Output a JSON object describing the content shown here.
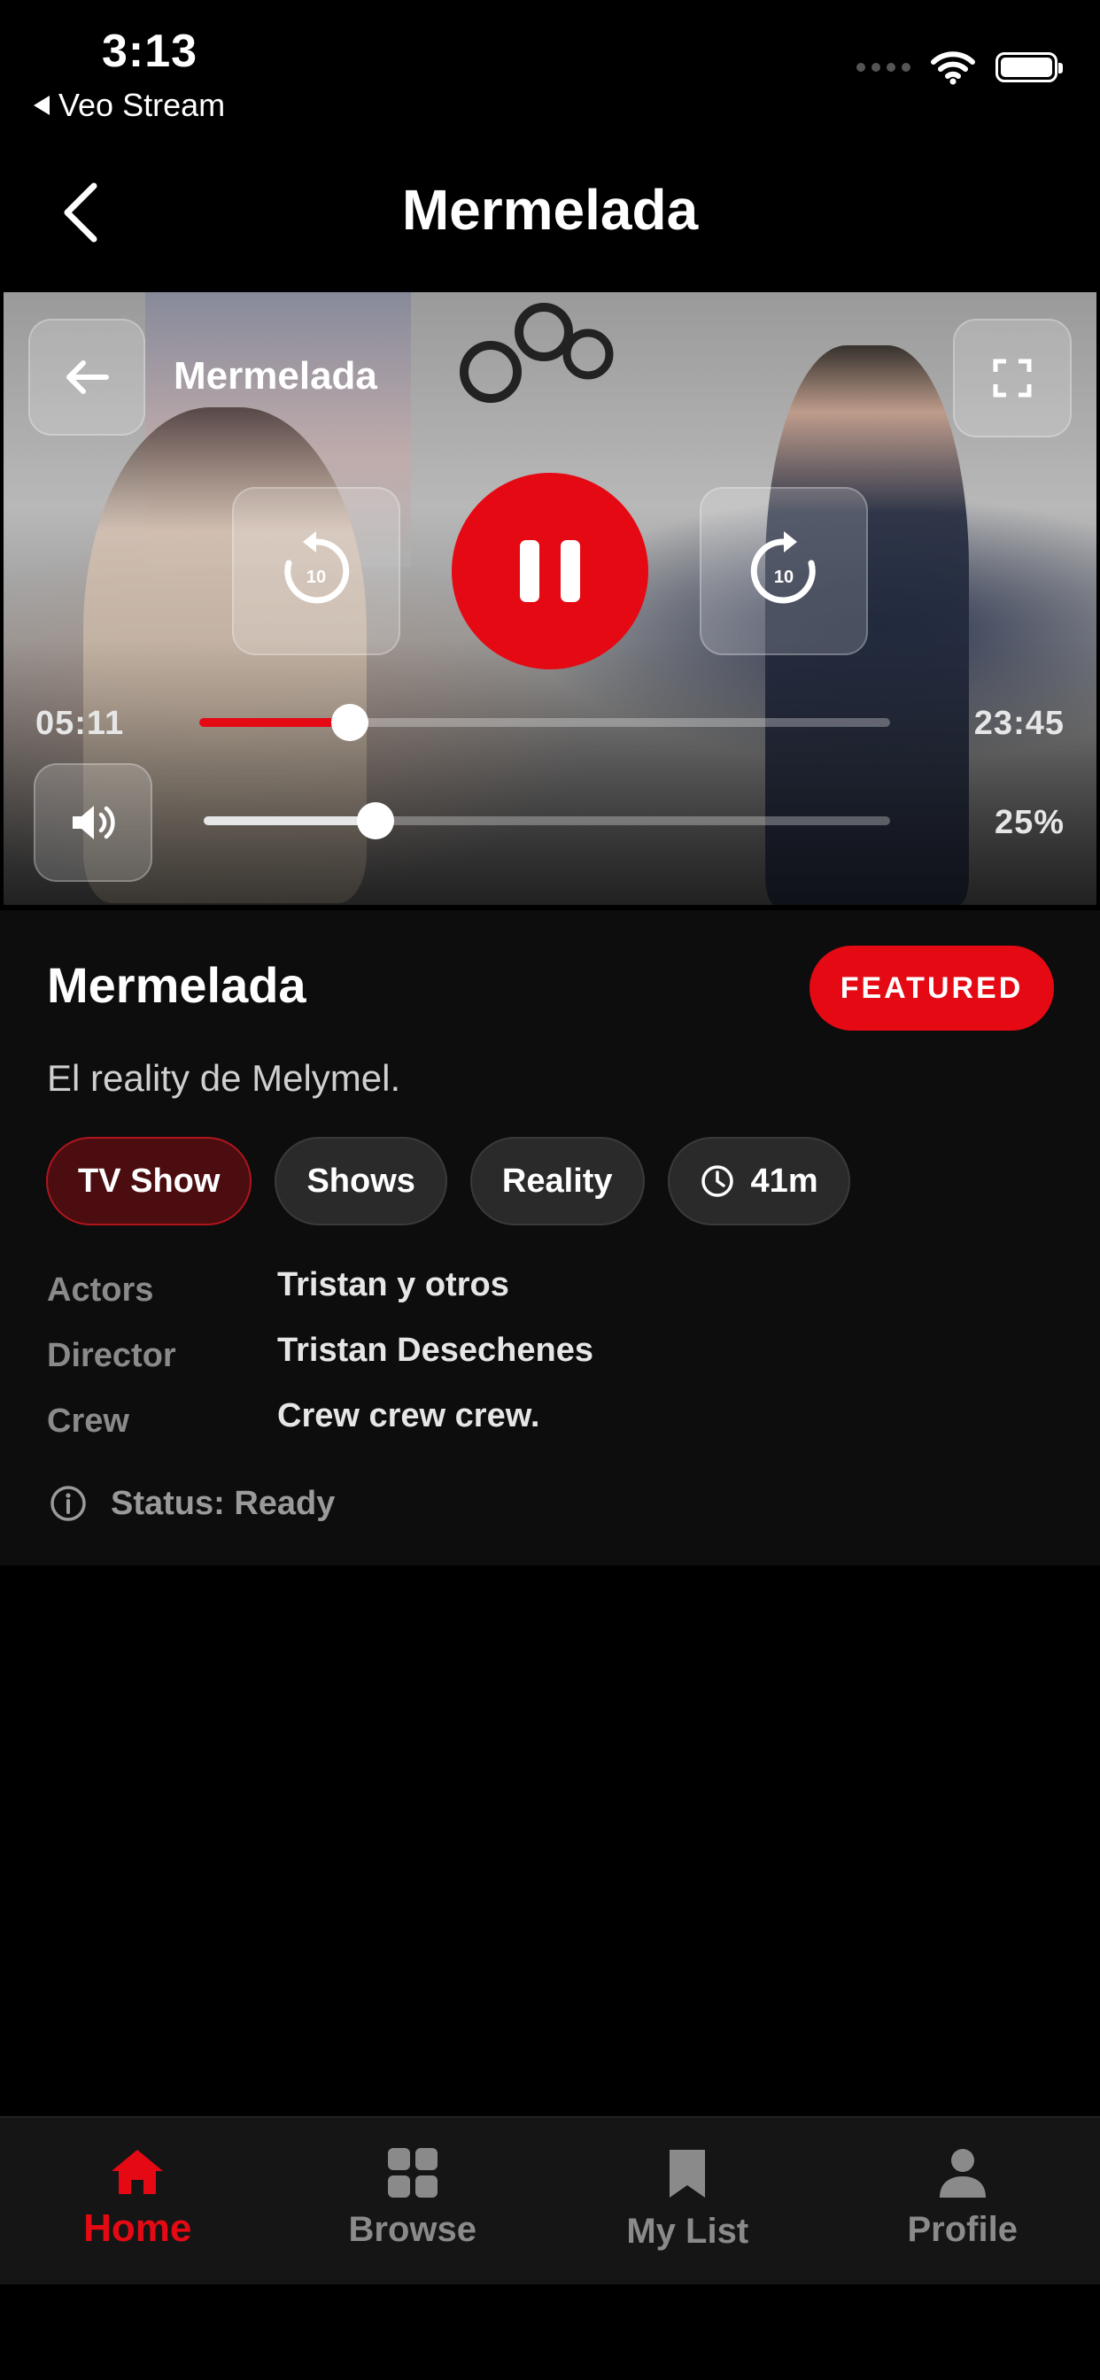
{
  "status_bar": {
    "time": "3:13",
    "back_app": "Veo Stream"
  },
  "header": {
    "title": "Mermelada"
  },
  "player": {
    "title": "Mermelada",
    "current_time": "05:11",
    "duration": "23:45",
    "progress_fraction": 0.218,
    "volume_label": "25%",
    "volume_fraction": 0.25,
    "skip_back_seconds": "10",
    "skip_forward_seconds": "10"
  },
  "info": {
    "title": "Mermelada",
    "badge": "FEATURED",
    "description": "El reality de Melymel.",
    "chips": [
      "TV Show",
      "Shows",
      "Reality",
      "41m"
    ],
    "credits": [
      {
        "label": "Actors",
        "value": "Tristan y otros"
      },
      {
        "label": "Director",
        "value": "Tristan Desechenes"
      },
      {
        "label": "Crew",
        "value": "Crew crew crew."
      }
    ],
    "status": "Status: Ready"
  },
  "tabs": [
    {
      "label": "Home",
      "icon": "home-icon"
    },
    {
      "label": "Browse",
      "icon": "grid-icon"
    },
    {
      "label": "My List",
      "icon": "bookmark-icon"
    },
    {
      "label": "Profile",
      "icon": "person-icon"
    }
  ],
  "colors": {
    "accent": "#e50914",
    "background": "#000000",
    "panel": "#0d0d0d"
  }
}
